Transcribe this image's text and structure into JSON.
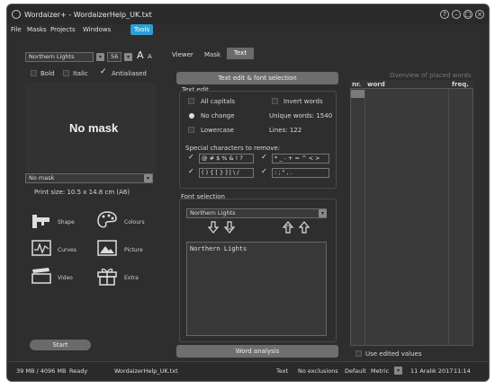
{
  "window": {
    "title": "Wordaizer+ - WordaizerHelp_UK.txt"
  },
  "menu": {
    "items": [
      "File",
      "Masks",
      "Projects",
      "Windows",
      "Tools"
    ]
  },
  "left": {
    "font_name": "Northern Lights",
    "font_size": "56",
    "bold": "Bold",
    "italic": "Italic",
    "antialiased": "Antialiased",
    "mask_placeholder": "No mask",
    "mask_select": "No mask",
    "print_size": "Print size: 10.5 x 14.8 cm (A6)",
    "tools": [
      "Shape",
      "Colours",
      "Curves",
      "Picture",
      "Video",
      "Extra"
    ],
    "start": "Start"
  },
  "tabs": {
    "viewer": "Viewer",
    "mask": "Mask",
    "text": "Text"
  },
  "text_panel": {
    "edit_button": "Text edit & font selection",
    "text_edit_label": "Text edit",
    "all_capitals": "All capitals",
    "no_change": "No change",
    "lowercase": "Lowercase",
    "invert_words": "Invert words",
    "unique_words": "Unique words: 1540",
    "lines": "Lines: 122",
    "special_label": "Special characters to remove:",
    "special_1": "@ # $ % & ! ?",
    "special_2": "* _ - + = ^ < >",
    "special_3": "( ) { [ } ] | \\ /",
    "special_4": ": ; \" , .",
    "font_selection_label": "Font selection",
    "font_combo": "Northern Lights",
    "font_list_item": "Northern Lights",
    "word_analysis": "Word analysis"
  },
  "overview": {
    "title": "Overview of placed words",
    "col_nr": "nr.",
    "col_word": "word",
    "col_freq": "freq.",
    "use_edited": "Use edited values"
  },
  "status": {
    "memory": "39 MB / 4096 MB",
    "state": "Ready",
    "file": "WordaizerHelp_UK.txt",
    "mode": "Text",
    "exclusions": "No exclusions",
    "profile": "Default",
    "units": "Metric",
    "date": "11 Aralık 2017",
    "time": "11:14"
  },
  "colors": {
    "accent": "#2d9ed6",
    "window_bg": "#2e2e2e"
  },
  "icons": [
    "app-icon",
    "help-icon",
    "minimize-icon",
    "maximize-icon",
    "close-icon",
    "font-size-up-icon",
    "font-size-down-icon",
    "shape-icon",
    "colours-icon",
    "curves-icon",
    "picture-icon",
    "video-icon",
    "extra-icon",
    "arrow-down-icon",
    "arrow-down-double-icon",
    "arrow-up-double-icon",
    "arrow-up-icon",
    "check-icon"
  ]
}
